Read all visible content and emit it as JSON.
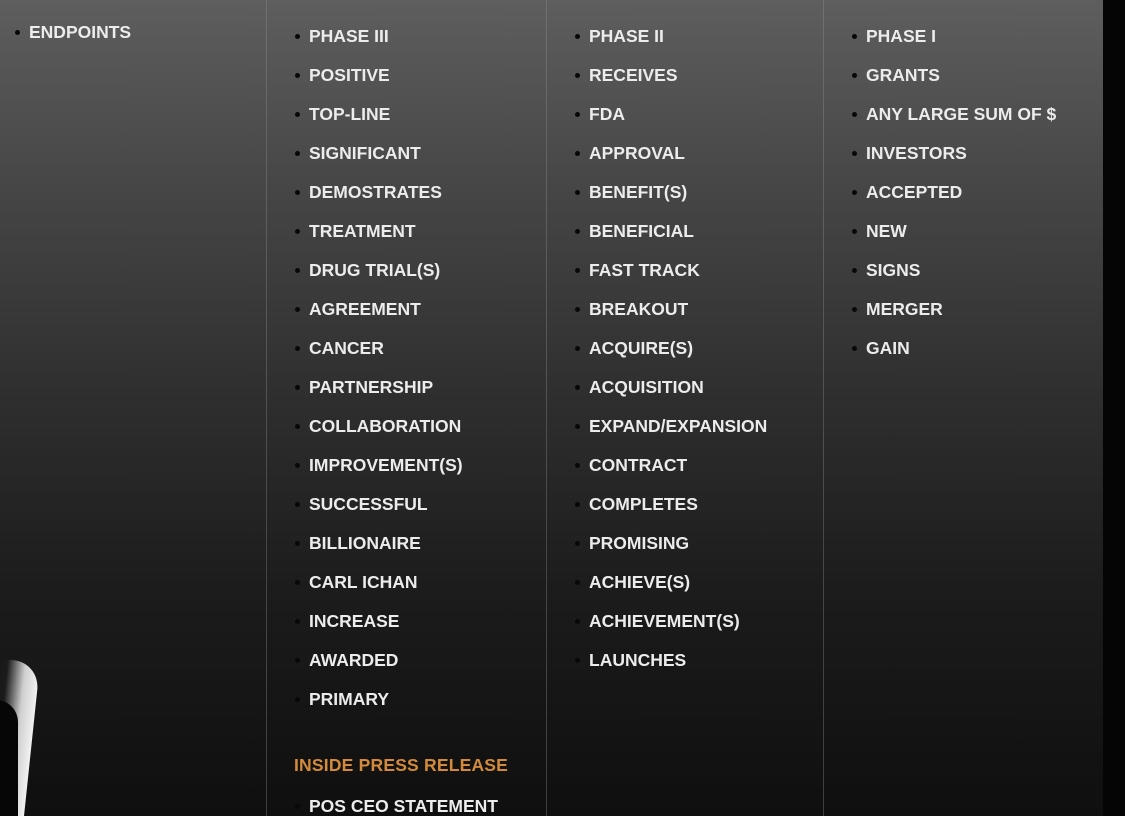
{
  "columns": [
    {
      "id": "col-1",
      "items": [
        "ENDPOINTS"
      ]
    },
    {
      "id": "col-2",
      "items": [
        "PHASE III",
        "POSITIVE",
        "TOP-LINE",
        "SIGNIFICANT",
        "DEMOSTRATES",
        "TREATMENT",
        "DRUG TRIAL(S)",
        "AGREEMENT",
        "CANCER",
        "PARTNERSHIP",
        "COLLABORATION",
        "IMPROVEMENT(S)",
        "SUCCESSFUL",
        "BILLIONAIRE",
        "CARL ICHAN",
        "INCREASE",
        "AWARDED",
        "PRIMARY"
      ]
    },
    {
      "id": "col-3",
      "items": [
        "PHASE II",
        "RECEIVES",
        "FDA",
        "APPROVAL",
        "BENEFIT(S)",
        "BENEFICIAL",
        "FAST TRACK",
        "BREAKOUT",
        "ACQUIRE(S)",
        "ACQUISITION",
        "EXPAND/EXPANSION",
        "CONTRACT",
        "COMPLETES",
        "PROMISING",
        "ACHIEVE(S)",
        "ACHIEVEMENT(S)",
        "LAUNCHES"
      ]
    },
    {
      "id": "col-4",
      "items": [
        "PHASE I",
        "GRANTS",
        "ANY LARGE SUM OF $",
        "INVESTORS",
        "ACCEPTED",
        "NEW",
        "SIGNS",
        "MERGER",
        "GAIN"
      ]
    }
  ],
  "inside_press_release": {
    "heading": "INSIDE PRESS RELEASE",
    "heading_color": "#d38a3a",
    "items": [
      "POS CEO STATEMENT"
    ]
  },
  "colors": {
    "text": "#ececec",
    "bullet": "#080808"
  }
}
